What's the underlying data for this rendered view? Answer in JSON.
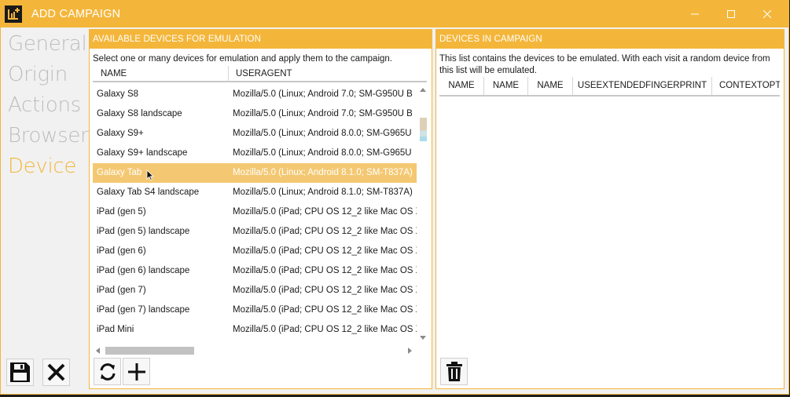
{
  "window": {
    "title": "ADD CAMPAIGN",
    "accent_color": "#f4b63a"
  },
  "nav": {
    "items": [
      {
        "label": "General",
        "active": false
      },
      {
        "label": "Origin",
        "active": false
      },
      {
        "label": "Actions",
        "active": false
      },
      {
        "label": "Browser",
        "active": false
      },
      {
        "label": "Device",
        "active": true
      }
    ]
  },
  "available": {
    "header": "AVAILABLE DEVICES FOR EMULATION",
    "description": "Select one or many devices for emulation and apply them to the campaign.",
    "columns": [
      "NAME",
      "USERAGENT"
    ],
    "rows": [
      {
        "name": "Galaxy S8",
        "useragent": "Mozilla/5.0 (Linux; Android 7.0; SM-G950U B",
        "selected": false
      },
      {
        "name": "Galaxy S8 landscape",
        "useragent": "Mozilla/5.0 (Linux; Android 7.0; SM-G950U B",
        "selected": false
      },
      {
        "name": "Galaxy S9+",
        "useragent": "Mozilla/5.0 (Linux; Android 8.0.0; SM-G965U",
        "selected": false
      },
      {
        "name": "Galaxy S9+ landscape",
        "useragent": "Mozilla/5.0 (Linux; Android 8.0.0; SM-G965U",
        "selected": false
      },
      {
        "name": "Galaxy Tab",
        "useragent": "Mozilla/5.0 (Linux; Android 8.1.0; SM-T837A)",
        "selected": true
      },
      {
        "name": "Galaxy Tab S4 landscape",
        "useragent": "Mozilla/5.0 (Linux; Android 8.1.0; SM-T837A)",
        "selected": false
      },
      {
        "name": "iPad (gen 5)",
        "useragent": "Mozilla/5.0 (iPad; CPU OS 12_2 like Mac OS X",
        "selected": false
      },
      {
        "name": "iPad (gen 5) landscape",
        "useragent": "Mozilla/5.0 (iPad; CPU OS 12_2 like Mac OS X",
        "selected": false
      },
      {
        "name": "iPad (gen 6)",
        "useragent": "Mozilla/5.0 (iPad; CPU OS 12_2 like Mac OS X",
        "selected": false
      },
      {
        "name": "iPad (gen 6) landscape",
        "useragent": "Mozilla/5.0 (iPad; CPU OS 12_2 like Mac OS X",
        "selected": false
      },
      {
        "name": "iPad (gen 7)",
        "useragent": "Mozilla/5.0 (iPad; CPU OS 12_2 like Mac OS X",
        "selected": false
      },
      {
        "name": "iPad (gen 7) landscape",
        "useragent": "Mozilla/5.0 (iPad; CPU OS 12_2 like Mac OS X",
        "selected": false
      },
      {
        "name": "iPad Mini",
        "useragent": "Mozilla/5.0 (iPad; CPU OS 12_2 like Mac OS X",
        "selected": false
      }
    ]
  },
  "campaign": {
    "header": "DEVICES IN CAMPAIGN",
    "description": "This list contains the devices to be emulated. With each visit a random device from this list will be emulated.",
    "columns": [
      "NAME",
      "NAME",
      "NAME",
      "USEEXTENDEDFINGERPRINT",
      "CONTEXTOPT"
    ]
  },
  "icons": {
    "app": "app-logo-icon",
    "save": "floppy-disk-icon",
    "cancel": "close-x-icon",
    "refresh": "refresh-icon",
    "add": "plus-icon",
    "delete": "trash-icon"
  }
}
